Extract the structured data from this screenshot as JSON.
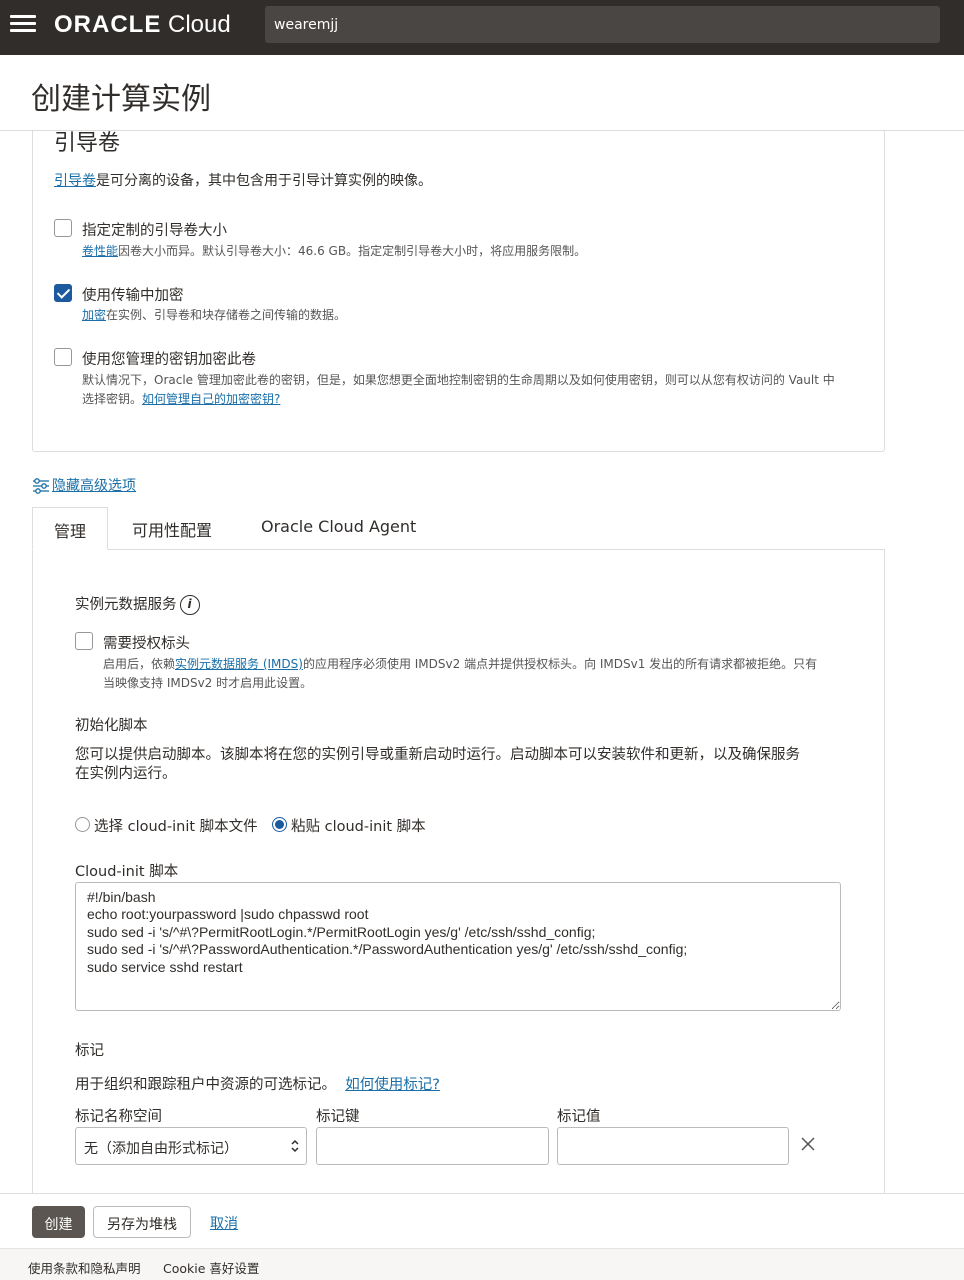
{
  "topbar": {
    "logo_bold": "ORACLE",
    "logo_light": " Cloud",
    "search_value": "wearemjj"
  },
  "page": {
    "title": "创建计算实例"
  },
  "boot_volume": {
    "heading": "引导卷",
    "desc_link": "引导卷",
    "desc_rest": "是可分离的设备，其中包含用于引导计算实例的映像。",
    "custom_size": {
      "label": "指定定制的引导卷大小",
      "help_link": "卷性能",
      "help_rest": "因卷大小而异。默认引导卷大小：46.6 GB。指定定制引导卷大小时，将应用服务限制。",
      "checked": false
    },
    "in_transit": {
      "label": "使用传输中加密",
      "help_link": "加密",
      "help_rest": "在实例、引导卷和块存储卷之间传输的数据。",
      "checked": true
    },
    "own_key": {
      "label": "使用您管理的密钥加密此卷",
      "help_line1": "默认情况下，Oracle 管理加密此卷的密钥，但是，如果您想更全面地控制密钥的生命周期以及如何使用密钥，则可以从您有权访问的 Vault 中",
      "help_line2_pre": "选择密钥。",
      "help_link": "如何管理自己的加密密钥?",
      "checked": false
    }
  },
  "advanced": {
    "toggle_label": "隐藏高级选项"
  },
  "tabs": [
    {
      "label": "管理"
    },
    {
      "label": "可用性配置"
    },
    {
      "label": "Oracle Cloud Agent"
    }
  ],
  "management": {
    "imds_title": "实例元数据服务",
    "imds_info": "i",
    "auth_header": {
      "label": "需要授权标头",
      "checked": false,
      "help_pre": "启用后，依赖",
      "help_link": "实例元数据服务 (IMDS)",
      "help_post": "的应用程序必须使用 IMDSv2 端点并提供授权标头。向 IMDSv1 发出的所有请求都被拒绝。只有",
      "help_line2": "当映像支持 IMDSv2 时才启用此设置。"
    },
    "init_title": "初始化脚本",
    "init_desc_1": "您可以提供启动脚本。该脚本将在您的实例引导或重新启动时运行。启动脚本可以安装软件和更新，以及确保服务",
    "init_desc_2": "在实例内运行。",
    "radio_file": "选择 cloud-init 脚本文件",
    "radio_paste": "粘贴 cloud-init 脚本",
    "selected_radio": "paste",
    "script_label": "Cloud-init 脚本",
    "script_value": "#!/bin/bash\necho root:yourpassword |sudo chpasswd root\nsudo sed -i 's/^#\\?PermitRootLogin.*/PermitRootLogin yes/g' /etc/ssh/sshd_config;\nsudo sed -i 's/^#\\?PasswordAuthentication.*/PasswordAuthentication yes/g' /etc/ssh/sshd_config;\nsudo service sshd restart",
    "tags_title": "标记",
    "tags_desc": "用于组织和跟踪租户中资源的可选标记。",
    "tags_link": "如何使用标记?",
    "tag_ns_label": "标记名称空间",
    "tag_key_label": "标记键",
    "tag_value_label": "标记值",
    "tag_ns_value": "无（添加自由形式标记）",
    "tag_key_value": "",
    "tag_value_value": ""
  },
  "footer": {
    "create": "创建",
    "save_stack": "另存为堆栈",
    "cancel": "取消"
  },
  "legal": {
    "terms": "使用条款和隐私声明",
    "cookie": "Cookie 喜好设置"
  }
}
